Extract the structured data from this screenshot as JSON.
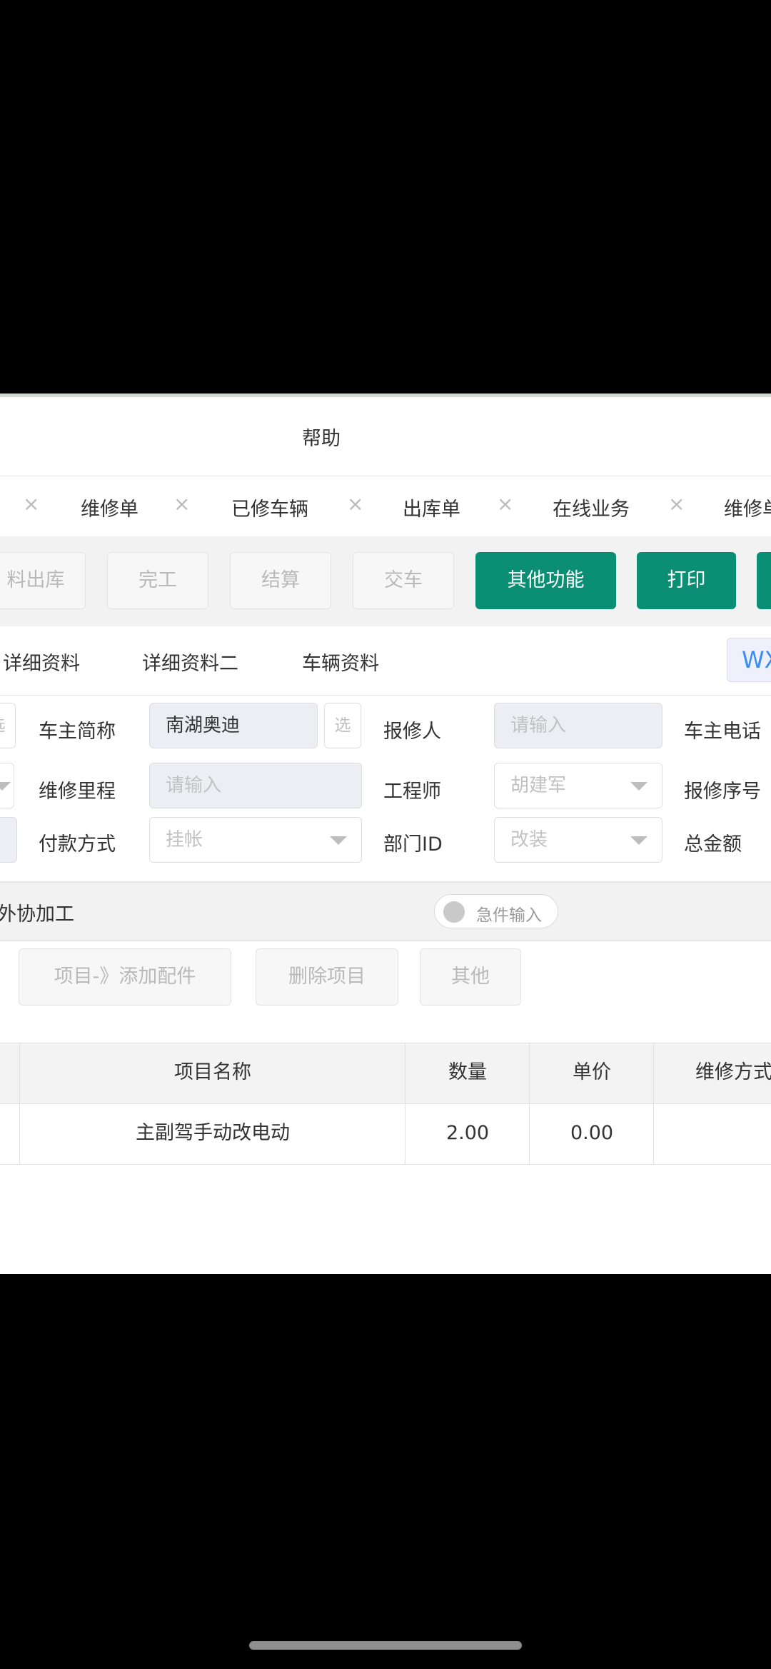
{
  "menu": {
    "help": "帮助"
  },
  "tabs": [
    {
      "label": "",
      "close": "×"
    },
    {
      "label": "维修单",
      "close": "×"
    },
    {
      "label": "已修车辆",
      "close": "×"
    },
    {
      "label": "出库单",
      "close": "×"
    },
    {
      "label": "在线业务",
      "close": "×"
    },
    {
      "label": "维修单",
      "close": ""
    }
  ],
  "toolbar": {
    "material_out": "料出库",
    "finish": "完工",
    "settle": "结算",
    "deliver": "交车",
    "other_functions": "其他功能",
    "print": "打印"
  },
  "subtabs": {
    "detail": "详细资料",
    "detail2": "详细资料二",
    "vehicle": "车辆资料",
    "wx": "WX"
  },
  "form": {
    "owner_short_label": "车主简称",
    "owner_short_value": "南湖奥迪",
    "select_btn": "选",
    "reporter_label": "报修人",
    "reporter_placeholder": "请输入",
    "owner_phone_label": "车主电话",
    "mileage_label": "维修里程",
    "mileage_placeholder": "请输入",
    "engineer_label": "工程师",
    "engineer_value": "胡建军",
    "report_no_label": "报修序号",
    "payment_label": "付款方式",
    "payment_value": "挂帐",
    "dept_label": "部门ID",
    "dept_value": "改装",
    "total_label": "总金额",
    "left_edge_select": "选"
  },
  "section": {
    "outsourcing": "外协加工",
    "urgent_input": "急件输入"
  },
  "item_toolbar": {
    "add_parts": "项目-》添加配件",
    "delete_item": "删除项目",
    "other": "其他"
  },
  "table": {
    "headers": [
      "项目名称",
      "数量",
      "单价",
      "维修方式"
    ],
    "rows": [
      [
        "主副驾手动改电动",
        "2.00",
        "0.00",
        ""
      ]
    ]
  }
}
